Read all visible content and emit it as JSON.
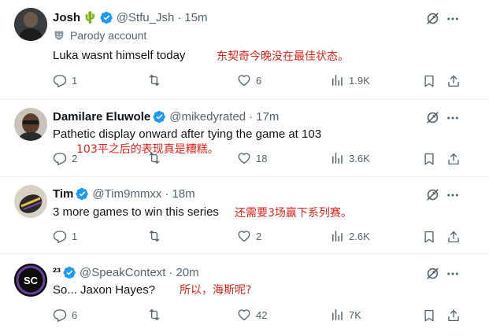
{
  "tweets": [
    {
      "name": "Josh",
      "emoji": "🌵",
      "handle": "@Stfu_Jsh",
      "dot": "·",
      "time": "15m",
      "parody_label": "Parody account",
      "text": "Luka wasnt himself today",
      "translation": "东契奇今晚没在最佳状态。",
      "replies": "1",
      "reposts": "",
      "likes": "6",
      "views": "1.9K"
    },
    {
      "name": "Damilare Eluwole",
      "handle": "@mikedyrated",
      "dot": "·",
      "time": "17m",
      "text": "Pathetic display onward after tying the game at 103",
      "translation": "103平之后的表现真是糟糕。",
      "replies": "2",
      "reposts": "",
      "likes": "18",
      "views": "3.6K"
    },
    {
      "name": "Tim",
      "handle": "@Tim9mmxx",
      "dot": "·",
      "time": "18m",
      "text": "3 more games to win this series",
      "translation": "还需要3场赢下系列赛。",
      "replies": "1",
      "reposts": "",
      "likes": "2",
      "views": "2.6K"
    },
    {
      "name": "²³",
      "handle": "@SpeakContext",
      "dot": "·",
      "time": "20m",
      "avatar_text": "SC",
      "text": "So... Jaxon Hayes?",
      "translation": "所以，海斯呢?",
      "replies": "6",
      "reposts": "",
      "likes": "42",
      "views": "7K"
    }
  ],
  "colors": {
    "verified": "#1d9bf0",
    "translation": "#e0241b",
    "muted": "#536471",
    "divider": "#eff3f4"
  },
  "icons": [
    "verified-badge-icon",
    "grok-icon",
    "more-icon",
    "reply-icon",
    "repost-icon",
    "like-icon",
    "views-icon",
    "bookmark-icon",
    "share-icon",
    "parody-mask-icon"
  ]
}
